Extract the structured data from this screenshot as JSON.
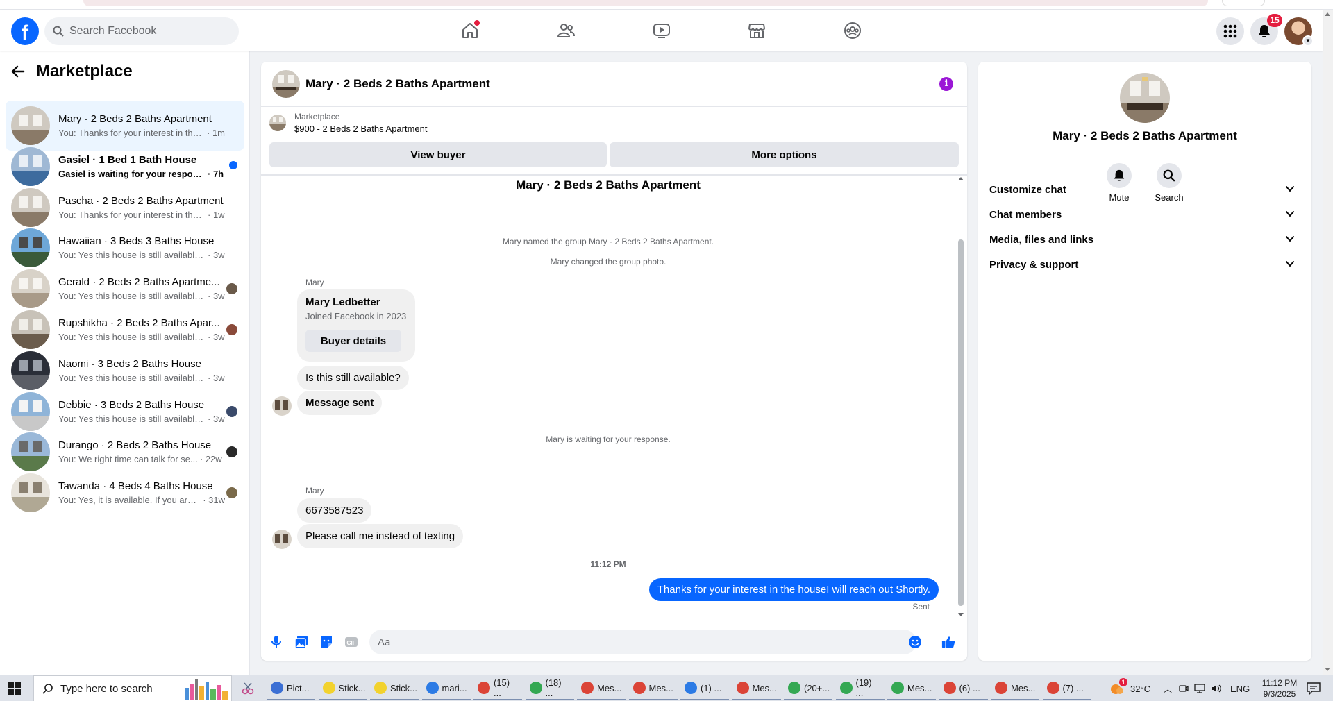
{
  "header": {
    "search_placeholder": "Search Facebook",
    "notifications_count": "15",
    "nav": [
      "home-icon",
      "friends-icon",
      "video-icon",
      "marketplace-icon",
      "groups-icon"
    ]
  },
  "sidebar": {
    "title": "Marketplace",
    "conversations": [
      {
        "name": "Mary · 2 Beds 2 Baths Apartment",
        "snippet": "You: Thanks for your interest in the h...",
        "time": "· 1m",
        "active": true,
        "unread": false
      },
      {
        "name": "Gasiel · 1 Bed 1 Bath House",
        "snippet": "Gasiel is waiting for your response.",
        "time": "· 7h",
        "active": false,
        "unread": true
      },
      {
        "name": "Pascha · 2 Beds 2 Baths Apartment",
        "snippet": "You: Thanks for your interest in the h...",
        "time": "· 1w",
        "active": false,
        "unread": false
      },
      {
        "name": "Hawaiian · 3 Beds 3 Baths House",
        "snippet": "You: Yes this house is still available for...",
        "time": "· 3w",
        "active": false,
        "unread": false
      },
      {
        "name": "Gerald · 2 Beds 2 Baths Apartme...",
        "snippet": "You: Yes this house is still available ...",
        "time": "· 3w",
        "active": false,
        "unread": false
      },
      {
        "name": "Rupshikha · 2 Beds 2 Baths Apar...",
        "snippet": "You: Yes this house is still available ...",
        "time": "· 3w",
        "active": false,
        "unread": false
      },
      {
        "name": "Naomi · 3 Beds 2 Baths House",
        "snippet": "You: Yes this house is still available for...",
        "time": "· 3w",
        "active": false,
        "unread": false
      },
      {
        "name": "Debbie · 3 Beds 2 Baths House",
        "snippet": "You: Yes this house is still available ...",
        "time": "· 3w",
        "active": false,
        "unread": false
      },
      {
        "name": "Durango · 2 Beds 2 Baths House",
        "snippet": "You: We right time can talk for se...",
        "time": "· 22w",
        "active": false,
        "unread": false
      },
      {
        "name": "Tawanda · 4 Beds 4 Baths House",
        "snippet": "You: Yes, it is available. If you are i...",
        "time": "· 31w",
        "active": false,
        "unread": false
      }
    ]
  },
  "chat": {
    "title": "Mary · 2 Beds 2 Baths Apartment",
    "marketplace_label": "Marketplace",
    "listing": "$900 - 2 Beds 2 Baths Apartment",
    "view_buyer": "View buyer",
    "more_options": "More options",
    "thread_title": "Mary · 2 Beds 2 Baths Apartment",
    "system_named": "Mary named the group Mary · 2 Beds 2 Baths Apartment.",
    "system_photo": "Mary changed the group photo.",
    "sender_1": "Mary",
    "card_name": "Mary Ledbetter",
    "card_sub": "Joined Facebook in 2023",
    "card_button": "Buyer details",
    "msg_available": "Is this still available?",
    "msg_sent": "Message sent",
    "waiting": "Mary is waiting for your response.",
    "sender_2": "Mary",
    "msg_phone": "6673587523",
    "msg_call": "Please call me instead of texting",
    "timestamp": "11:12 PM",
    "msg_out": "Thanks for your interest in the houseI will reach out Shortly.",
    "sent_status": "Sent",
    "composer_placeholder": "Aa"
  },
  "info_panel": {
    "name": "Mary · 2 Beds 2 Baths Apartment",
    "mute": "Mute",
    "search": "Search",
    "sections": [
      "Customize chat",
      "Chat members",
      "Media, files and links",
      "Privacy & support"
    ]
  },
  "taskbar": {
    "search_placeholder": "Type here to search",
    "apps": [
      {
        "label": "Pict...",
        "color": "#3b6fd4"
      },
      {
        "label": "Stick...",
        "color": "#f2d22e"
      },
      {
        "label": "Stick...",
        "color": "#f2d22e"
      },
      {
        "label": "mari...",
        "color": "#2c7be5"
      },
      {
        "label": "(15) ...",
        "color": "#db4437"
      },
      {
        "label": "(18) ...",
        "color": "#34a853"
      },
      {
        "label": "Mes...",
        "color": "#db4437"
      },
      {
        "label": "Mes...",
        "color": "#db4437"
      },
      {
        "label": "(1) ...",
        "color": "#2c7be5"
      },
      {
        "label": "Mes...",
        "color": "#db4437"
      },
      {
        "label": "(20+...",
        "color": "#34a853"
      },
      {
        "label": "(19) ...",
        "color": "#34a853"
      },
      {
        "label": "Mes...",
        "color": "#34a853"
      },
      {
        "label": "(6) ...",
        "color": "#db4437"
      },
      {
        "label": "Mes...",
        "color": "#db4437"
      },
      {
        "label": "(7) ...",
        "color": "#db4437"
      }
    ],
    "weather": "32°C",
    "lang": "ENG",
    "time": "11:12 PM",
    "date": "9/3/2025",
    "notif_badge": "1"
  },
  "colors": {
    "brand": "#0866ff",
    "info": "#9b17d6",
    "badge": "#e41e3f"
  }
}
